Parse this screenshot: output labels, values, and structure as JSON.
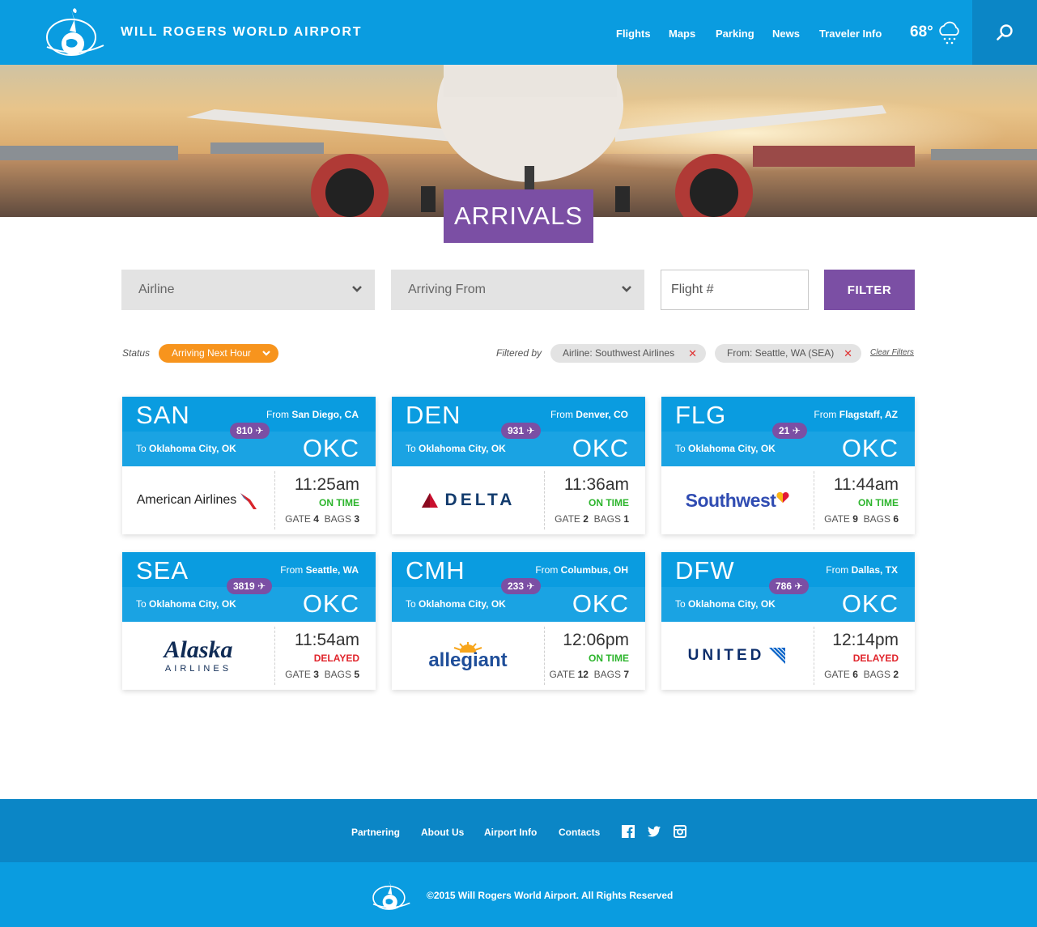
{
  "header": {
    "site_title": "WILL ROGERS WORLD AIRPORT",
    "nav": [
      "Flights",
      "Maps",
      "Parking",
      "News",
      "Traveler Info"
    ],
    "weather_temp": "68°"
  },
  "page_title": "ARRIVALS",
  "filters": {
    "airline_placeholder": "Airline",
    "arriving_from_placeholder": "Arriving From",
    "flight_placeholder": "Flight #",
    "filter_button": "FILTER",
    "status_label": "Status",
    "status_value": "Arriving Next Hour",
    "filtered_by_label": "Filtered by",
    "chips": [
      "Airline: Southwest Airlines",
      "From: Seattle, WA (SEA)"
    ],
    "clear_filters": "Clear Filters"
  },
  "flights": [
    {
      "from_code": "SAN",
      "from_prefix": "From",
      "from_city": "San Diego, CA",
      "to_prefix": "To",
      "to_city": "Oklahoma City, OK",
      "to_code": "OKC",
      "flight_no": "810",
      "airline": "American Airlines",
      "time": "11:25am",
      "status": "ON TIME",
      "gate_label": "GATE",
      "gate": "4",
      "bags_label": "BAGS",
      "bags": "3"
    },
    {
      "from_code": "DEN",
      "from_prefix": "From",
      "from_city": "Denver, CO",
      "to_prefix": "To",
      "to_city": "Oklahoma City, OK",
      "to_code": "OKC",
      "flight_no": "931",
      "airline": "DELTA",
      "time": "11:36am",
      "status": "ON TIME",
      "gate_label": "GATE",
      "gate": "2",
      "bags_label": "BAGS",
      "bags": "1"
    },
    {
      "from_code": "FLG",
      "from_prefix": "From",
      "from_city": "Flagstaff, AZ",
      "to_prefix": "To",
      "to_city": "Oklahoma City, OK",
      "to_code": "OKC",
      "flight_no": "21",
      "airline": "Southwest",
      "time": "11:44am",
      "status": "ON TIME",
      "gate_label": "GATE",
      "gate": "9",
      "bags_label": "BAGS",
      "bags": "6"
    },
    {
      "from_code": "SEA",
      "from_prefix": "From",
      "from_city": "Seattle, WA",
      "to_prefix": "To",
      "to_city": "Oklahoma City, OK",
      "to_code": "OKC",
      "flight_no": "3819",
      "airline": "Alaska",
      "airline_sub": "AIRLINES",
      "time": "11:54am",
      "status": "DELAYED",
      "gate_label": "GATE",
      "gate": "3",
      "bags_label": "BAGS",
      "bags": "5"
    },
    {
      "from_code": "CMH",
      "from_prefix": "From",
      "from_city": "Columbus, OH",
      "to_prefix": "To",
      "to_city": "Oklahoma City, OK",
      "to_code": "OKC",
      "flight_no": "233",
      "airline": "allegiant",
      "time": "12:06pm",
      "status": "ON TIME",
      "gate_label": "GATE",
      "gate": "12",
      "bags_label": "BAGS",
      "bags": "7"
    },
    {
      "from_code": "DFW",
      "from_prefix": "From",
      "from_city": "Dallas, TX",
      "to_prefix": "To",
      "to_city": "Oklahoma City, OK",
      "to_code": "OKC",
      "flight_no": "786",
      "airline": "UNITED",
      "time": "12:14pm",
      "status": "DELAYED",
      "gate_label": "GATE",
      "gate": "6",
      "bags_label": "BAGS",
      "bags": "2"
    }
  ],
  "footer": {
    "links": [
      "Partnering",
      "About Us",
      "Airport Info",
      "Contacts"
    ],
    "social_icons": [
      "facebook-icon",
      "twitter-icon",
      "instagram-icon"
    ],
    "copyright": "©2015 Will Rogers World Airport. All Rights Reserved"
  },
  "colors": {
    "brand_blue": "#0a9ce0",
    "dark_blue": "#0b86c6",
    "purple": "#7b4fa4",
    "orange": "#f7941d",
    "on_time": "#2db52d",
    "delayed": "#e0242b"
  }
}
